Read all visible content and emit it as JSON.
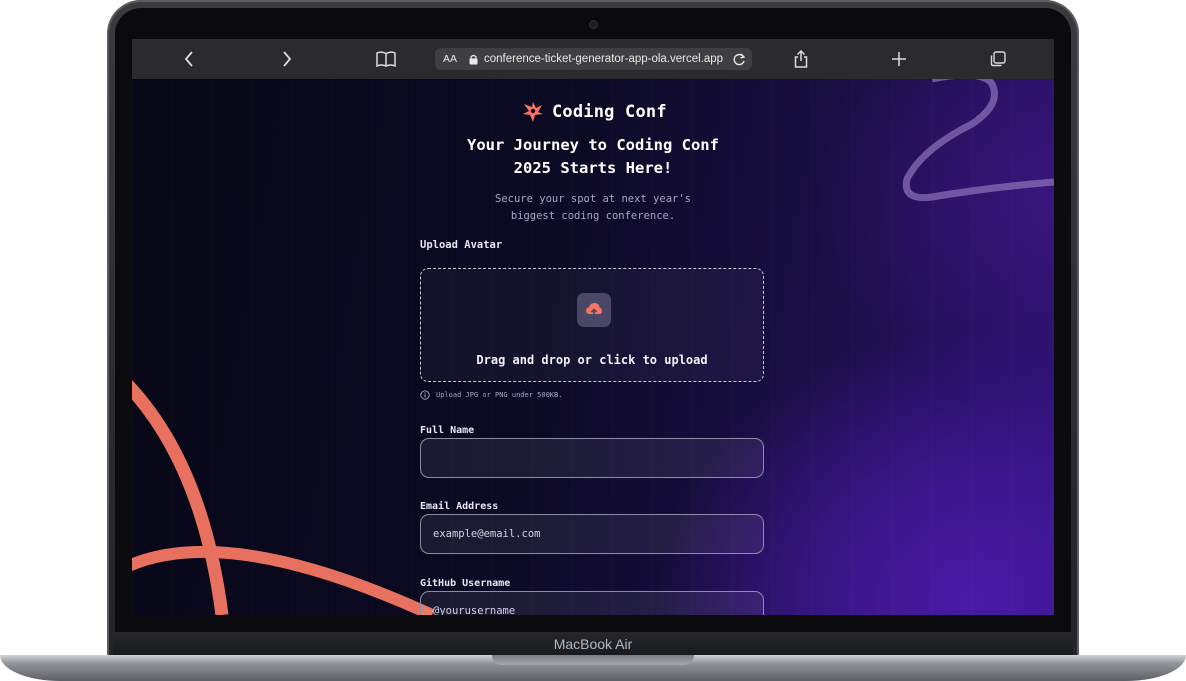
{
  "device": {
    "model_label": "MacBook Air"
  },
  "browser": {
    "url_aa": "AA",
    "url": "conference-ticket-generator-app-ola.vercel.app",
    "icons": [
      "chevron-left-icon",
      "chevron-right-icon",
      "book-icon",
      "lock-icon",
      "reload-icon",
      "share-icon",
      "plus-icon",
      "tabs-icon"
    ]
  },
  "page": {
    "brand": "Coding Conf",
    "headline": "Your Journey to Coding Conf 2025 Starts Here!",
    "subhead": "Secure your spot at next year's biggest coding conference.",
    "avatar": {
      "label": "Upload Avatar",
      "dropzone_text": "Drag and drop or click to upload",
      "hint": "Upload JPG or PNG under 500KB."
    },
    "form": {
      "full_name_label": "Full Name",
      "full_name_value": "",
      "email_label": "Email Address",
      "email_placeholder": "example@email.com",
      "github_label": "GitHub Username",
      "github_placeholder": "@yourusername"
    },
    "colors": {
      "accent": "#f57463",
      "background": "#0c0a22",
      "purple_glow": "#4a1aa6"
    }
  }
}
